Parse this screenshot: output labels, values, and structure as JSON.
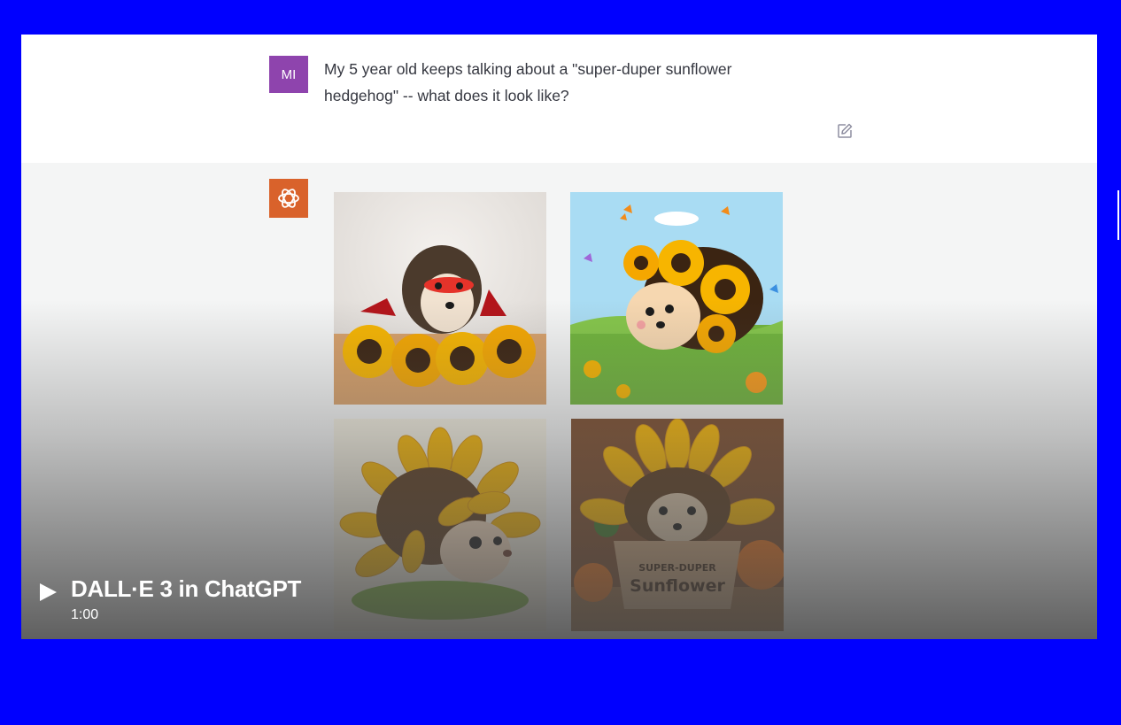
{
  "user_message": {
    "avatar_initials": "MI",
    "avatar_color": "#8e44ad",
    "text": "My 5 year old keeps talking about a \"super-duper sunflower\nhedgehog\" -- what does it look like?",
    "edit_icon": "edit-icon"
  },
  "assistant": {
    "avatar_icon": "openai-logo-icon",
    "avatar_color": "#d9622b",
    "images": [
      {
        "name": "hedgehog-with-red-mask-and-cape"
      },
      {
        "name": "cartoon-hedgehog-in-sunflower-meadow"
      },
      {
        "name": "hedgehog-with-sunflower-petal-spines"
      },
      {
        "name": "hedgehog-in-sunflower-pot",
        "pot_label_line1": "SUPER-DUPER",
        "pot_label_line2": "Sunflower"
      }
    ]
  },
  "video": {
    "play_icon": "play-icon",
    "title": "DALL·E 3 in ChatGPT",
    "duration": "1:00"
  },
  "colors": {
    "border": "#0000ff",
    "sunflower_petal": "#f7b500",
    "sunflower_center": "#3b2412"
  }
}
